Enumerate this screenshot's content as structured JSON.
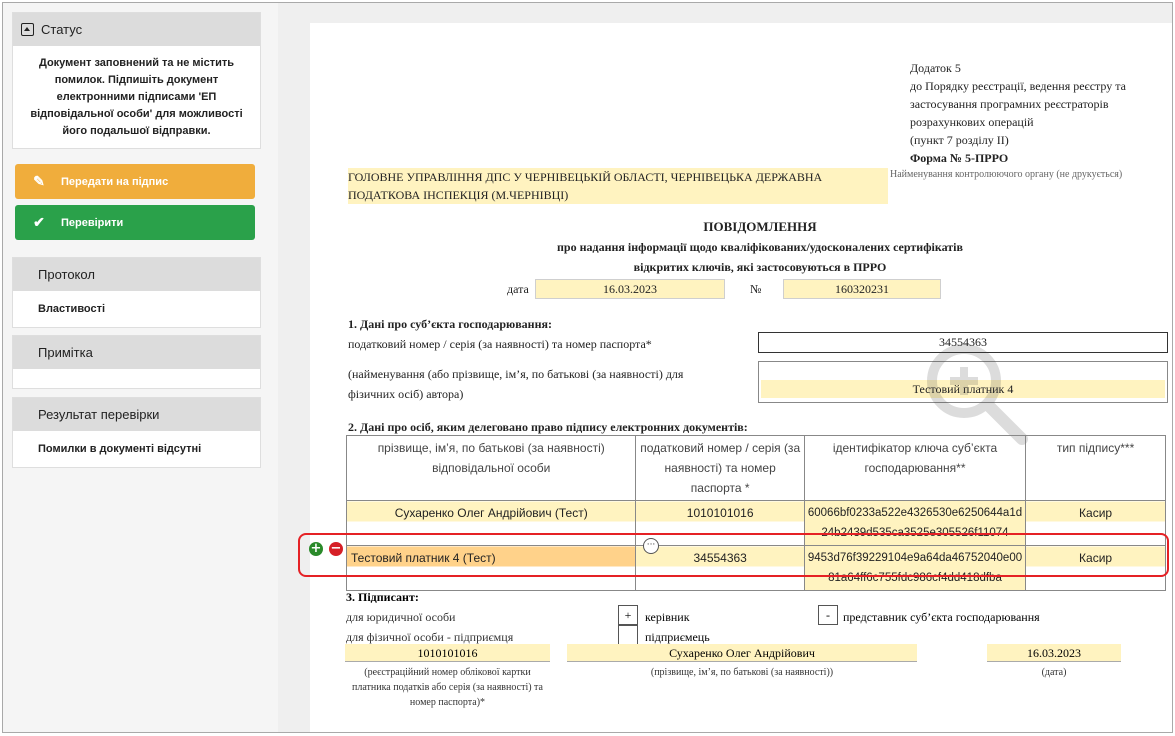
{
  "sidebar": {
    "status_title": "Статус",
    "status_message": "Документ заповнений та не містить помилок. Підпишіть документ електронними підписами 'ЕП відповідальної особи' для можливості його подальшої відправки.",
    "sign_button": "Передати на підпис",
    "check_button": "Перевірити",
    "protocol_title": "Протокол",
    "protocol_item": "Властивості",
    "note_title": "Примітка",
    "note_body": "",
    "result_title": "Результат перевірки",
    "result_body": "Помилки в документі відсутні"
  },
  "document": {
    "addendum": {
      "line1": "Додаток 5",
      "line2": "до Порядку реєстрації, ведення реєстру та",
      "line3": "застосування програмних реєстраторів",
      "line4": "розрахункових операцій",
      "line5": "(пункт 7 розділу ІІ)",
      "form": "Форма № 5-ПРРО"
    },
    "authority": "ГОЛОВНЕ УПРАВЛІННЯ ДПС У ЧЕРНІВЕЦЬКІЙ ОБЛАСТІ, ЧЕРНІВЕЦЬКА ДЕРЖАВНА ПОДАТКОВА ІНСПЕКЦІЯ (М.ЧЕРНІВЦІ)",
    "authority_note": "Найменування контролюючого органу (не друкується)",
    "title": "ПОВІДОМЛЕННЯ",
    "subtitle1": "про надання інформації щодо кваліфікованих/удосконалених сертифікатів",
    "subtitle2": "відкритих ключів, які застосовуються в ПРРО",
    "date_label": "дата",
    "date_value": "16.03.2023",
    "number_label": "№",
    "number_value": "160320231",
    "section1_title": "1. Дані про суб’єкта господарювання:",
    "tax_id_label": "податковий номер / серія (за наявності) та номер паспорта*",
    "tax_id_value": "34554363",
    "name_label_1": "(найменування (або прізвище, ім’я, по батькові (за наявності) для",
    "name_label_2": "фізичних осіб) автора)",
    "name_value": "Тестовий платник 4",
    "section2_title": "2. Дані про осіб, яким делеговано право підпису електронних документів:",
    "table": {
      "headers": [
        "прізвище, ім’я, по батькові (за наявності) відповідальної особи",
        "податковий номер / серія (за наявності) та номер паспорта *",
        "ідентифікатор ключа суб’єкта господарювання**",
        "тип підпису***"
      ],
      "rows": [
        {
          "name": "Сухаренко Олег Андрійович (Тест)",
          "tax_id": "1010101016",
          "key_id_1": "60066bf0233a522e4326530e6250644a1d",
          "key_id_2": "24b2439d535ca3525e305526f11074",
          "sign_type": "Касир"
        },
        {
          "name": "Тестовий платник 4 (Тест)",
          "tax_id": "34554363",
          "key_id_1": "9453d76f39229104e9a64da46752040e00",
          "key_id_2": "81a64ff6c755fdc986cf4dd418dfba",
          "sign_type": "Касир"
        }
      ]
    },
    "section3_title": "3. Підписант:",
    "legal_label": "для юридичної особи",
    "individual_label": "для фізичної особи - підприємця",
    "head_mark": "+",
    "head_label": "керівник",
    "rep_mark": "-",
    "rep_label": "представник суб’єкта господарювання",
    "entrepreneur_mark": "",
    "entrepreneur_label": "підприємець",
    "sig_tax_id": "1010101016",
    "sig_tax_caption_1": "(реєстраційний номер облікової картки",
    "sig_tax_caption_2": "платника податків або серія (за наявності) та",
    "sig_tax_caption_3": "номер паспорта)*",
    "sig_name": "Сухаренко Олег Андрійович",
    "sig_name_caption": "(прізвище, ім’я, по батькові (за наявності))",
    "sig_date": "16.03.2023",
    "sig_date_caption": "(дата)"
  },
  "colors": {
    "highlight": "#fff3c0",
    "selected_cell": "#ffd28a",
    "sign_button": "#f0ad3c",
    "check_button": "#2aa14a",
    "selection_border": "#e52125"
  }
}
